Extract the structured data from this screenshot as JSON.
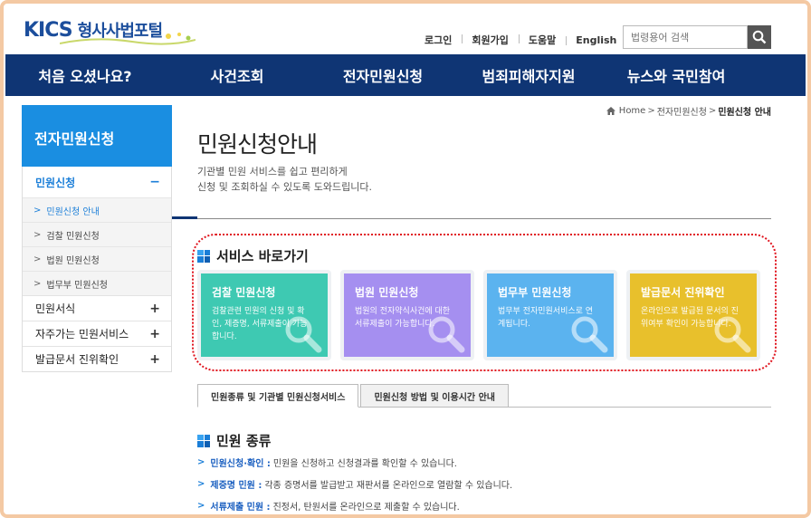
{
  "header": {
    "logo_mark": "KICS",
    "logo_text": "형사사법포털",
    "util_links": [
      "로그인",
      "회원가입",
      "도움말",
      "English"
    ],
    "search_placeholder": "법령용어 검색"
  },
  "gnb": [
    "처음 오셨나요?",
    "사건조회",
    "전자민원신청",
    "범죄피해자지원",
    "뉴스와 국민참여"
  ],
  "sidebar": {
    "title": "전자민원신청",
    "active_group": {
      "label": "민원신청",
      "sign": "−"
    },
    "sub_items": [
      {
        "label": "민원신청 안내",
        "active": true
      },
      {
        "label": "검찰 민원신청",
        "active": false
      },
      {
        "label": "법원 민원신청",
        "active": false
      },
      {
        "label": "법무부 민원신청",
        "active": false
      }
    ],
    "groups": [
      {
        "label": "민원서식",
        "sign": "+"
      },
      {
        "label": "자주가는 민원서비스",
        "sign": "+"
      },
      {
        "label": "발급문서 진위확인",
        "sign": "+"
      }
    ]
  },
  "breadcrumb": {
    "home": "Home",
    "level1": "전자민원신청",
    "current": "민원신청 안내"
  },
  "main": {
    "title": "민원신청안내",
    "intro_line1": "기관별 민원 서비스를 쉽고 편리하게",
    "intro_line2": "신청 및 조회하실 수 있도록 도와드립니다.",
    "service_title": "서비스 바로가기",
    "cards": [
      {
        "title": "검찰 민원신청",
        "line1": "검찰관련 민원의 신청 및 확",
        "line2": "인, 제증명, 서류제출이 가능",
        "line3": "합니다.",
        "color": "#3ec9b2"
      },
      {
        "title": "법원 민원신청",
        "line1": "법원의 전자약식사건에 대한",
        "line2": "서류제출이 가능합니다.",
        "line3": "",
        "color": "#a58ff0"
      },
      {
        "title": "법무부 민원신청",
        "line1": "법무부 전자민원서비스로 연",
        "line2": "계됩니다.",
        "line3": "",
        "color": "#5bb3ef"
      },
      {
        "title": "발급문서 진위확인",
        "line1": "온라인으로 발급된 문서의 진",
        "line2": "위여부 확인이 가능합니다.",
        "line3": "",
        "color": "#e8c02c"
      }
    ],
    "tabs": [
      "민원종류 및 기관별 민원신청서비스",
      "민원신청 방법 및 이용시간 안내"
    ],
    "kinds_title": "민원 종류",
    "kinds": [
      {
        "term": "민원신청·확인 :",
        "desc": "민원을 신청하고 신청결과를 확인할 수 있습니다."
      },
      {
        "term": "제증명 민원 :",
        "desc": "각종 증명서를 발급받고 재판서를 온라인으로 열람할 수 있습니다."
      },
      {
        "term": "서류제출 민원 :",
        "desc": "진정서, 탄원서를 온라인으로 제출할 수 있습니다."
      }
    ]
  }
}
